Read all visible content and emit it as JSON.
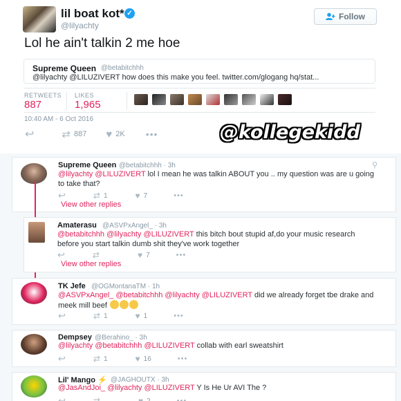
{
  "tweet": {
    "name": "lil boat kot*",
    "handle": "@lilyachty",
    "follow_label": "Follow",
    "text": "Lol he ain't talkin 2 me hoe",
    "quote": {
      "name": "Supreme Queen",
      "handle": "@betabitchhh",
      "text": "@lilyachty @LILUZIVERT how does this make you feel. twitter.com/glogang hq/stat..."
    },
    "retweets_label": "RETWEETS",
    "retweets": "887",
    "likes_label": "LIKES",
    "likes": "1,965",
    "timestamp": "10:40 AM - 6 Oct 2016",
    "actions": {
      "retweets": "887",
      "likes": "2K"
    }
  },
  "watermark": "@kollegekidd",
  "colors": {
    "accent": "#e0245e",
    "verified": "#1da1f2",
    "muted": "#8899a6"
  },
  "replies": [
    {
      "name": "Supreme Queen",
      "handle": "@betabitchhh · 3h",
      "mentions": "@lilyachty @LILUZIVERT",
      "text": " lol I mean he was talkin ABOUT you .. my question was are u going to take that?",
      "retweets": "1",
      "likes": "7",
      "view_other": "View other replies"
    },
    {
      "name": "Amaterasu",
      "handle": "@ASVPxAngel_ · 3h",
      "mentions": "@betabitchhh @lilyachty @LILUZIVERT",
      "text": " this bitch bout stupid af,do your music research before you start talkin dumb shit they've work together",
      "retweets": "",
      "likes": "7",
      "view_other": "View other replies"
    },
    {
      "name": "TK Jefe",
      "handle": "@OGMontanaTM · 1h",
      "mentions": "@ASVPxAngel_ @betabitchhh @lilyachty @LILUZIVERT",
      "text": " did we already forget tbe drake and meek mill beef",
      "retweets": "1",
      "likes": "1"
    },
    {
      "name": "Dempsey",
      "handle": "@Berahino_ · 3h",
      "mentions": "@lilyachty @betabitchhh @LILUZIVERT",
      "text": " collab with earl sweatshirt",
      "retweets": "1",
      "likes": "16"
    },
    {
      "name": "Lil' Mango ⚡",
      "handle": "@JAGHOUTX · 3h",
      "mentions": "@JasAndJoi_ @lilyachty @LILUZIVERT",
      "text": " Y Is He Ur AVI The ?",
      "retweets": "",
      "likes": "2"
    }
  ]
}
